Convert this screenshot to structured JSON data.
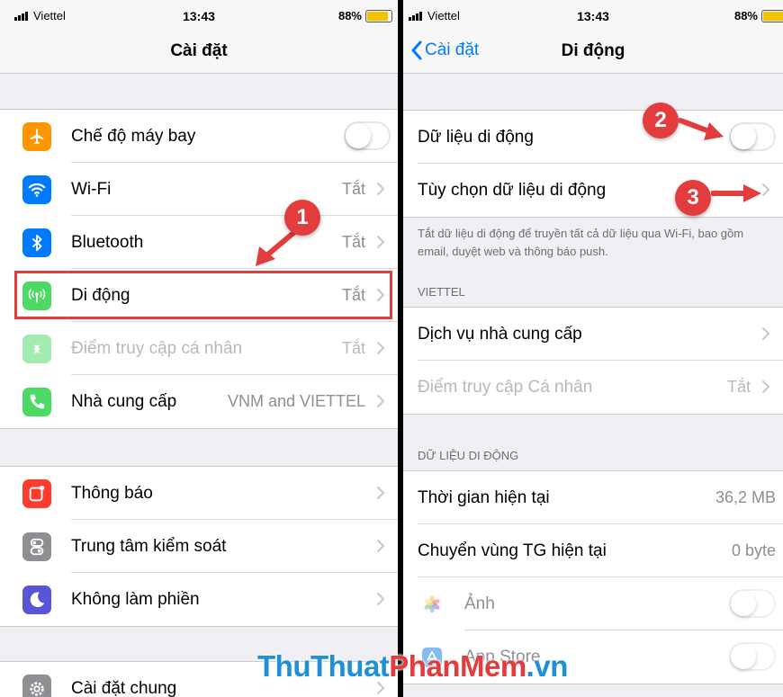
{
  "left": {
    "status": {
      "carrier": "Viettel",
      "time": "13:43",
      "battery": "88%"
    },
    "title": "Cài đặt",
    "group1": [
      {
        "label": "Chế độ máy bay",
        "value": "",
        "type": "toggle",
        "color": "#ff9500",
        "icon": "airplane-icon"
      },
      {
        "label": "Wi-Fi",
        "value": "Tắt",
        "type": "chevron",
        "color": "#007aff",
        "icon": "wifi-icon"
      },
      {
        "label": "Bluetooth",
        "value": "Tắt",
        "type": "chevron",
        "color": "#007aff",
        "icon": "bluetooth-icon"
      },
      {
        "label": "Di động",
        "value": "Tắt",
        "type": "chevron",
        "color": "#4cd964",
        "icon": "cellular-icon"
      },
      {
        "label": "Điểm truy cập cá nhân",
        "value": "Tắt",
        "type": "chevron",
        "color": "#4cd964",
        "icon": "hotspot-icon",
        "dim": true
      },
      {
        "label": "Nhà cung cấp",
        "value": "VNM and VIETTEL",
        "type": "chevron",
        "color": "#4cd964",
        "icon": "phone-icon"
      }
    ],
    "group2": [
      {
        "label": "Thông báo",
        "color": "#ff3b30",
        "icon": "notifications-icon"
      },
      {
        "label": "Trung tâm kiểm soát",
        "color": "#8e8e93",
        "icon": "control-center-icon"
      },
      {
        "label": "Không làm phiền",
        "color": "#5856d6",
        "icon": "moon-icon"
      }
    ],
    "group3": [
      {
        "label": "Cài đặt chung",
        "color": "#8e8e93",
        "icon": "gear-icon"
      }
    ]
  },
  "right": {
    "status": {
      "carrier": "Viettel",
      "time": "13:43",
      "battery": "88%"
    },
    "back_label": "Cài đặt",
    "title": "Di động",
    "group1": [
      {
        "label": "Dữ liệu di động",
        "type": "toggle"
      },
      {
        "label": "Tùy chọn dữ liệu di động",
        "type": "chevron"
      }
    ],
    "note": "Tắt dữ liệu di động để truyền tất cả dữ liệu qua Wi-Fi, bao gồm email, duyệt web và thông báo push.",
    "viettel_header": "VIETTEL",
    "group2": [
      {
        "label": "Dịch vụ nhà cung cấp",
        "value": ""
      },
      {
        "label": "Điểm truy cập Cá nhân",
        "value": "Tắt",
        "dim": true
      }
    ],
    "data_header": "DỮ LIỆU DI ĐỘNG",
    "group3": [
      {
        "label": "Thời gian hiện tại",
        "value": "36,2 MB"
      },
      {
        "label": "Chuyển vùng TG hiện tại",
        "value": "0 byte"
      }
    ],
    "apps": [
      {
        "label": "Ảnh",
        "icon": "photos-icon"
      },
      {
        "label": "App Store",
        "icon": "app-store-icon"
      }
    ]
  },
  "annotations": {
    "step1": "1",
    "step2": "2",
    "step3": "3",
    "accent": "#e23c3c"
  },
  "watermark": {
    "part1": "ThuThuat",
    "part2": "PhanMem",
    "part3": ".vn"
  }
}
